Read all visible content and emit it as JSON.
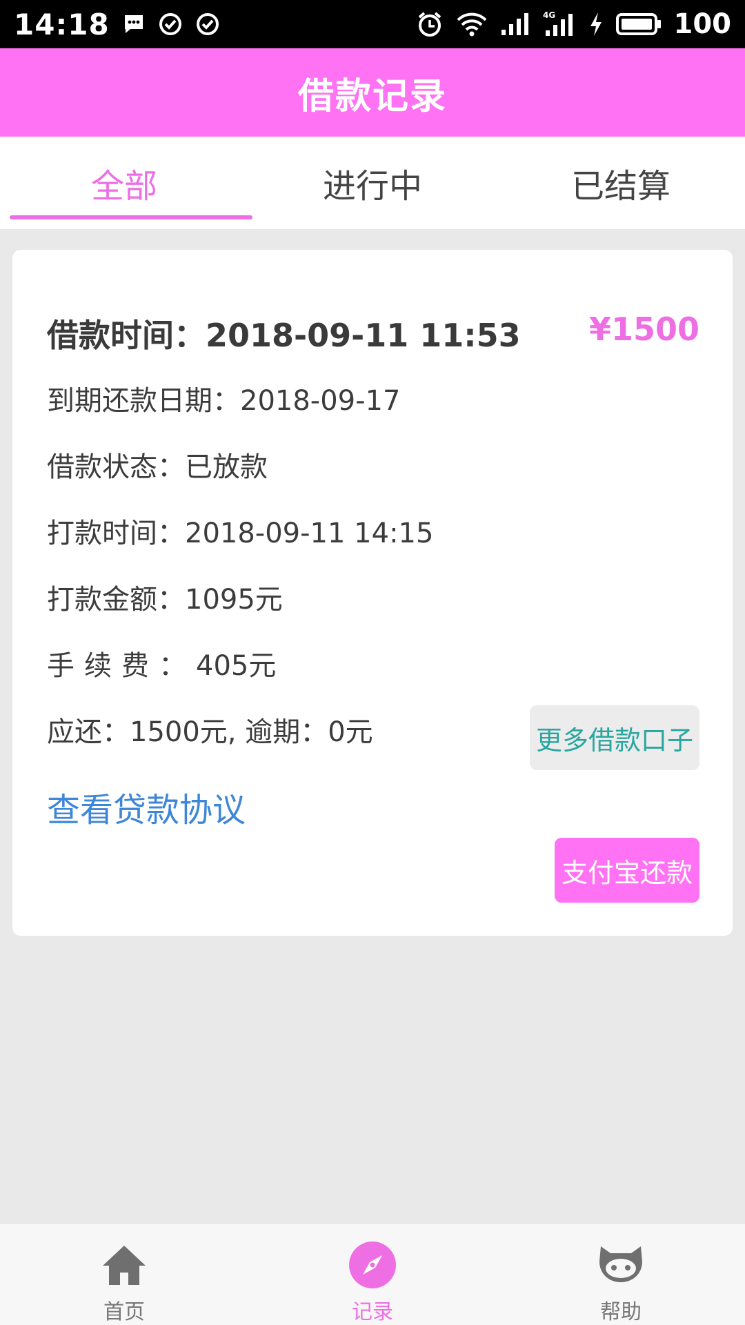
{
  "status_bar": {
    "time": "14:18",
    "battery": "100",
    "network": "4G",
    "icons": [
      "message-icon",
      "check-circle-icon",
      "check-circle-icon",
      "alarm-icon",
      "wifi-icon",
      "signal-icon",
      "signal-4g-icon",
      "charging-icon",
      "battery-icon"
    ]
  },
  "header": {
    "title": "借款记录"
  },
  "tabs": [
    {
      "label": "全部",
      "active": true
    },
    {
      "label": "进行中",
      "active": false
    },
    {
      "label": "已结算",
      "active": false
    }
  ],
  "record": {
    "loan_time_label": "借款时间：",
    "loan_time_value": "2018-09-11 11:53",
    "amount": "¥1500",
    "due_date": "到期还款日期：2018-09-17",
    "status": "借款状态：已放款",
    "payout_time": "打款时间：2018-09-11 14:15",
    "payout_amount": "打款金额：1095元",
    "fee_label": "手续费：",
    "fee_value": "405元",
    "repay": "应还：1500元, 逾期：0元",
    "agreement_link": "查看贷款协议",
    "more_button": "更多借款口子",
    "pay_button": "支付宝还款"
  },
  "bottom_nav": [
    {
      "label": "首页",
      "icon": "home-icon",
      "active": false
    },
    {
      "label": "记录",
      "icon": "compass-icon",
      "active": true
    },
    {
      "label": "帮助",
      "icon": "github-cat-icon",
      "active": false
    }
  ],
  "colors": {
    "accent": "#ff72f3",
    "accent_text": "#ee6fe4",
    "link": "#3d86d8",
    "teal": "#2aa6a0",
    "background": "#e9e9e9"
  }
}
